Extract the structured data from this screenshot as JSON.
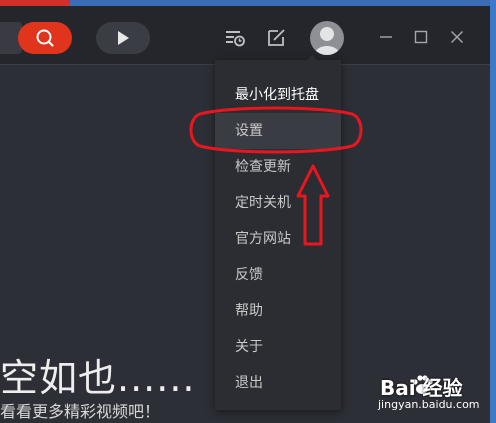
{
  "toolbar": {
    "search_icon": "search-icon",
    "play_icon": "play-icon"
  },
  "colors": {
    "accent": "#e0341c",
    "annotation": "#e8161e"
  },
  "main": {
    "empty_title": "空如也......",
    "empty_subtitle": "看看更多精彩视频吧！"
  },
  "menu": {
    "items": [
      {
        "label": "最小化到托盘"
      },
      {
        "label": "设置"
      },
      {
        "label": "检查更新"
      },
      {
        "label": "定时关机"
      },
      {
        "label": "官方网站"
      },
      {
        "label": "反馈"
      },
      {
        "label": "帮助"
      },
      {
        "label": "关于"
      },
      {
        "label": "退出"
      }
    ]
  },
  "watermark": {
    "brand": "Bai 经验",
    "url": "jingyan.baidu.com"
  }
}
